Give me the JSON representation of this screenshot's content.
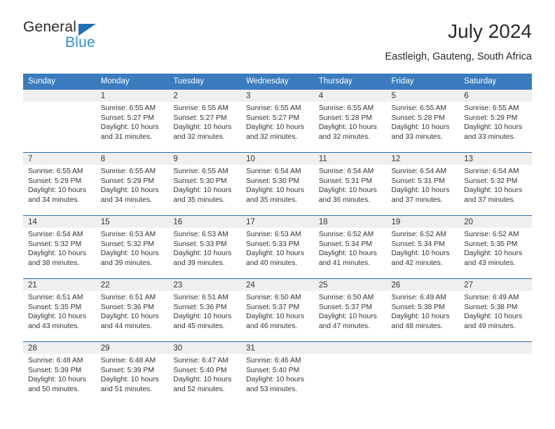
{
  "brand": {
    "name_top": "General",
    "name_bottom": "Blue",
    "accent_dark_blue": "#1f6fb5",
    "accent_light_blue": "#2d8fd5"
  },
  "header": {
    "title": "July 2024",
    "subtitle": "Eastleigh, Gauteng, South Africa"
  },
  "theme": {
    "header_row_bg": "#3a7cbe",
    "header_row_text": "#ffffff",
    "daynum_band_bg": "#efefef",
    "row_separator": "#2f6ca8",
    "body_text": "#333333"
  },
  "calendar": {
    "weekday_headers": [
      "Sunday",
      "Monday",
      "Tuesday",
      "Wednesday",
      "Thursday",
      "Friday",
      "Saturday"
    ],
    "weeks": [
      [
        {
          "day": "",
          "empty": true,
          "sunrise": "",
          "sunset": "",
          "daylight_1": "",
          "daylight_2": ""
        },
        {
          "day": "1",
          "empty": false,
          "sunrise": "Sunrise: 6:55 AM",
          "sunset": "Sunset: 5:27 PM",
          "daylight_1": "Daylight: 10 hours",
          "daylight_2": "and 31 minutes."
        },
        {
          "day": "2",
          "empty": false,
          "sunrise": "Sunrise: 6:55 AM",
          "sunset": "Sunset: 5:27 PM",
          "daylight_1": "Daylight: 10 hours",
          "daylight_2": "and 32 minutes."
        },
        {
          "day": "3",
          "empty": false,
          "sunrise": "Sunrise: 6:55 AM",
          "sunset": "Sunset: 5:27 PM",
          "daylight_1": "Daylight: 10 hours",
          "daylight_2": "and 32 minutes."
        },
        {
          "day": "4",
          "empty": false,
          "sunrise": "Sunrise: 6:55 AM",
          "sunset": "Sunset: 5:28 PM",
          "daylight_1": "Daylight: 10 hours",
          "daylight_2": "and 32 minutes."
        },
        {
          "day": "5",
          "empty": false,
          "sunrise": "Sunrise: 6:55 AM",
          "sunset": "Sunset: 5:28 PM",
          "daylight_1": "Daylight: 10 hours",
          "daylight_2": "and 33 minutes."
        },
        {
          "day": "6",
          "empty": false,
          "sunrise": "Sunrise: 6:55 AM",
          "sunset": "Sunset: 5:29 PM",
          "daylight_1": "Daylight: 10 hours",
          "daylight_2": "and 33 minutes."
        }
      ],
      [
        {
          "day": "7",
          "empty": false,
          "sunrise": "Sunrise: 6:55 AM",
          "sunset": "Sunset: 5:29 PM",
          "daylight_1": "Daylight: 10 hours",
          "daylight_2": "and 34 minutes."
        },
        {
          "day": "8",
          "empty": false,
          "sunrise": "Sunrise: 6:55 AM",
          "sunset": "Sunset: 5:29 PM",
          "daylight_1": "Daylight: 10 hours",
          "daylight_2": "and 34 minutes."
        },
        {
          "day": "9",
          "empty": false,
          "sunrise": "Sunrise: 6:55 AM",
          "sunset": "Sunset: 5:30 PM",
          "daylight_1": "Daylight: 10 hours",
          "daylight_2": "and 35 minutes."
        },
        {
          "day": "10",
          "empty": false,
          "sunrise": "Sunrise: 6:54 AM",
          "sunset": "Sunset: 5:30 PM",
          "daylight_1": "Daylight: 10 hours",
          "daylight_2": "and 35 minutes."
        },
        {
          "day": "11",
          "empty": false,
          "sunrise": "Sunrise: 6:54 AM",
          "sunset": "Sunset: 5:31 PM",
          "daylight_1": "Daylight: 10 hours",
          "daylight_2": "and 36 minutes."
        },
        {
          "day": "12",
          "empty": false,
          "sunrise": "Sunrise: 6:54 AM",
          "sunset": "Sunset: 5:31 PM",
          "daylight_1": "Daylight: 10 hours",
          "daylight_2": "and 37 minutes."
        },
        {
          "day": "13",
          "empty": false,
          "sunrise": "Sunrise: 6:54 AM",
          "sunset": "Sunset: 5:32 PM",
          "daylight_1": "Daylight: 10 hours",
          "daylight_2": "and 37 minutes."
        }
      ],
      [
        {
          "day": "14",
          "empty": false,
          "sunrise": "Sunrise: 6:54 AM",
          "sunset": "Sunset: 5:32 PM",
          "daylight_1": "Daylight: 10 hours",
          "daylight_2": "and 38 minutes."
        },
        {
          "day": "15",
          "empty": false,
          "sunrise": "Sunrise: 6:53 AM",
          "sunset": "Sunset: 5:32 PM",
          "daylight_1": "Daylight: 10 hours",
          "daylight_2": "and 39 minutes."
        },
        {
          "day": "16",
          "empty": false,
          "sunrise": "Sunrise: 6:53 AM",
          "sunset": "Sunset: 5:33 PM",
          "daylight_1": "Daylight: 10 hours",
          "daylight_2": "and 39 minutes."
        },
        {
          "day": "17",
          "empty": false,
          "sunrise": "Sunrise: 6:53 AM",
          "sunset": "Sunset: 5:33 PM",
          "daylight_1": "Daylight: 10 hours",
          "daylight_2": "and 40 minutes."
        },
        {
          "day": "18",
          "empty": false,
          "sunrise": "Sunrise: 6:52 AM",
          "sunset": "Sunset: 5:34 PM",
          "daylight_1": "Daylight: 10 hours",
          "daylight_2": "and 41 minutes."
        },
        {
          "day": "19",
          "empty": false,
          "sunrise": "Sunrise: 6:52 AM",
          "sunset": "Sunset: 5:34 PM",
          "daylight_1": "Daylight: 10 hours",
          "daylight_2": "and 42 minutes."
        },
        {
          "day": "20",
          "empty": false,
          "sunrise": "Sunrise: 6:52 AM",
          "sunset": "Sunset: 5:35 PM",
          "daylight_1": "Daylight: 10 hours",
          "daylight_2": "and 43 minutes."
        }
      ],
      [
        {
          "day": "21",
          "empty": false,
          "sunrise": "Sunrise: 6:51 AM",
          "sunset": "Sunset: 5:35 PM",
          "daylight_1": "Daylight: 10 hours",
          "daylight_2": "and 43 minutes."
        },
        {
          "day": "22",
          "empty": false,
          "sunrise": "Sunrise: 6:51 AM",
          "sunset": "Sunset: 5:36 PM",
          "daylight_1": "Daylight: 10 hours",
          "daylight_2": "and 44 minutes."
        },
        {
          "day": "23",
          "empty": false,
          "sunrise": "Sunrise: 6:51 AM",
          "sunset": "Sunset: 5:36 PM",
          "daylight_1": "Daylight: 10 hours",
          "daylight_2": "and 45 minutes."
        },
        {
          "day": "24",
          "empty": false,
          "sunrise": "Sunrise: 6:50 AM",
          "sunset": "Sunset: 5:37 PM",
          "daylight_1": "Daylight: 10 hours",
          "daylight_2": "and 46 minutes."
        },
        {
          "day": "25",
          "empty": false,
          "sunrise": "Sunrise: 6:50 AM",
          "sunset": "Sunset: 5:37 PM",
          "daylight_1": "Daylight: 10 hours",
          "daylight_2": "and 47 minutes."
        },
        {
          "day": "26",
          "empty": false,
          "sunrise": "Sunrise: 6:49 AM",
          "sunset": "Sunset: 5:38 PM",
          "daylight_1": "Daylight: 10 hours",
          "daylight_2": "and 48 minutes."
        },
        {
          "day": "27",
          "empty": false,
          "sunrise": "Sunrise: 6:49 AM",
          "sunset": "Sunset: 5:38 PM",
          "daylight_1": "Daylight: 10 hours",
          "daylight_2": "and 49 minutes."
        }
      ],
      [
        {
          "day": "28",
          "empty": false,
          "sunrise": "Sunrise: 6:48 AM",
          "sunset": "Sunset: 5:39 PM",
          "daylight_1": "Daylight: 10 hours",
          "daylight_2": "and 50 minutes."
        },
        {
          "day": "29",
          "empty": false,
          "sunrise": "Sunrise: 6:48 AM",
          "sunset": "Sunset: 5:39 PM",
          "daylight_1": "Daylight: 10 hours",
          "daylight_2": "and 51 minutes."
        },
        {
          "day": "30",
          "empty": false,
          "sunrise": "Sunrise: 6:47 AM",
          "sunset": "Sunset: 5:40 PM",
          "daylight_1": "Daylight: 10 hours",
          "daylight_2": "and 52 minutes."
        },
        {
          "day": "31",
          "empty": false,
          "sunrise": "Sunrise: 6:46 AM",
          "sunset": "Sunset: 5:40 PM",
          "daylight_1": "Daylight: 10 hours",
          "daylight_2": "and 53 minutes."
        },
        {
          "day": "",
          "empty": true,
          "sunrise": "",
          "sunset": "",
          "daylight_1": "",
          "daylight_2": ""
        },
        {
          "day": "",
          "empty": true,
          "sunrise": "",
          "sunset": "",
          "daylight_1": "",
          "daylight_2": ""
        },
        {
          "day": "",
          "empty": true,
          "sunrise": "",
          "sunset": "",
          "daylight_1": "",
          "daylight_2": ""
        }
      ]
    ]
  }
}
